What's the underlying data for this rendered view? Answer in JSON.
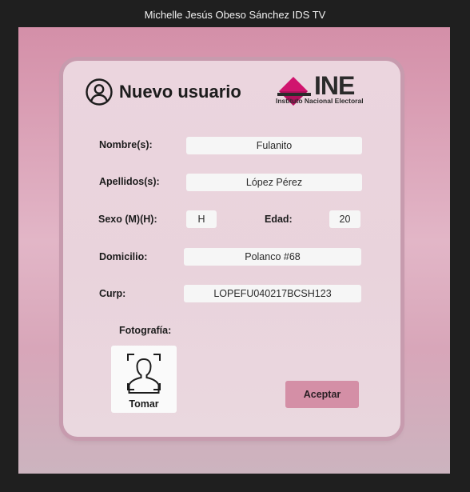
{
  "window": {
    "title": "Michelle Jesús Obeso Sánchez IDS TV"
  },
  "header": {
    "title": "Nuevo usuario",
    "logo": {
      "text": "INE",
      "subtitle": "Instituto Nacional Electoral",
      "accent": "#d0146e"
    }
  },
  "form": {
    "nombre": {
      "label": "Nombre(s):",
      "value": "Fulanito"
    },
    "apellidos": {
      "label": "Apellidos(s):",
      "value": "López Pérez"
    },
    "sexo": {
      "label": "Sexo (M)(H):",
      "value": "H"
    },
    "edad": {
      "label": "Edad:",
      "value": "20"
    },
    "domicilio": {
      "label": "Domicilio:",
      "value": "Polanco #68"
    },
    "curp": {
      "label": "Curp:",
      "value": "LOPEFU040217BCSH123"
    },
    "foto": {
      "label": "Fotografía:",
      "button": "Tomar"
    },
    "accept": "Aceptar"
  },
  "colors": {
    "background": "#1f1f1f",
    "frame": "#d8a6b9",
    "card": "#ebd5de",
    "button": "#d48fa6"
  },
  "icons": {
    "user": "user-circle-icon",
    "photo": "camera-portrait-icon",
    "logo": "ine-logo-icon"
  }
}
